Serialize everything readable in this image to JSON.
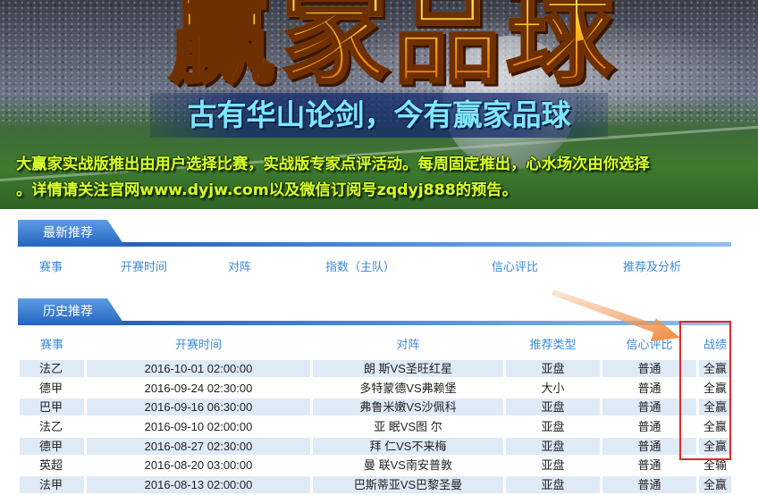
{
  "banner": {
    "title": "赢家品球",
    "slogan": "古有华山论剑，今有赢家品球",
    "desc_line1": "大赢家实战版推出由用户选择比赛，实战版专家点评活动。每周固定推出，心水场次由你选择",
    "desc_line2": "。详情请关注官网www.dyjw.com以及微信订阅号zqdyj888的预告。"
  },
  "latest": {
    "tab_label": "最新推荐",
    "columns": [
      "赛事",
      "开赛时间",
      "对阵",
      "指数（主队）",
      "信心评比",
      "推荐及分析"
    ]
  },
  "history": {
    "tab_label": "历史推荐",
    "columns": [
      "赛事",
      "开赛时间",
      "对阵",
      "推荐类型",
      "信心评比",
      "战绩"
    ],
    "rows": [
      [
        "法乙",
        "2016-10-01 02:00:00",
        "朗 斯VS圣旺红星",
        "亚盘",
        "普通",
        "全赢"
      ],
      [
        "德甲",
        "2016-09-24 02:30:00",
        "多特蒙德VS弗赖堡",
        "大小",
        "普通",
        "全赢"
      ],
      [
        "巴甲",
        "2016-09-16 06:30:00",
        "弗鲁米嫩VS沙佩科",
        "亚盘",
        "普通",
        "全赢"
      ],
      [
        "法乙",
        "2016-09-10 02:00:00",
        "亚 眠VS图 尔",
        "亚盘",
        "普通",
        "全赢"
      ],
      [
        "德甲",
        "2016-08-27 02:30:00",
        "拜 仁VS不来梅",
        "亚盘",
        "普通",
        "全赢"
      ],
      [
        "英超",
        "2016-08-20 03:00:00",
        "曼 联VS南安普敦",
        "亚盘",
        "普通",
        "全输"
      ],
      [
        "法甲",
        "2016-08-13 02:00:00",
        "巴斯蒂亚VS巴黎圣曼",
        "亚盘",
        "普通",
        "全赢"
      ]
    ]
  },
  "colors": {
    "accent_blue": "#3d8bd8",
    "row_highlight": "#dfeaf7",
    "annotation_red": "#e5262b",
    "annotation_arrow": "#f08a3c"
  }
}
